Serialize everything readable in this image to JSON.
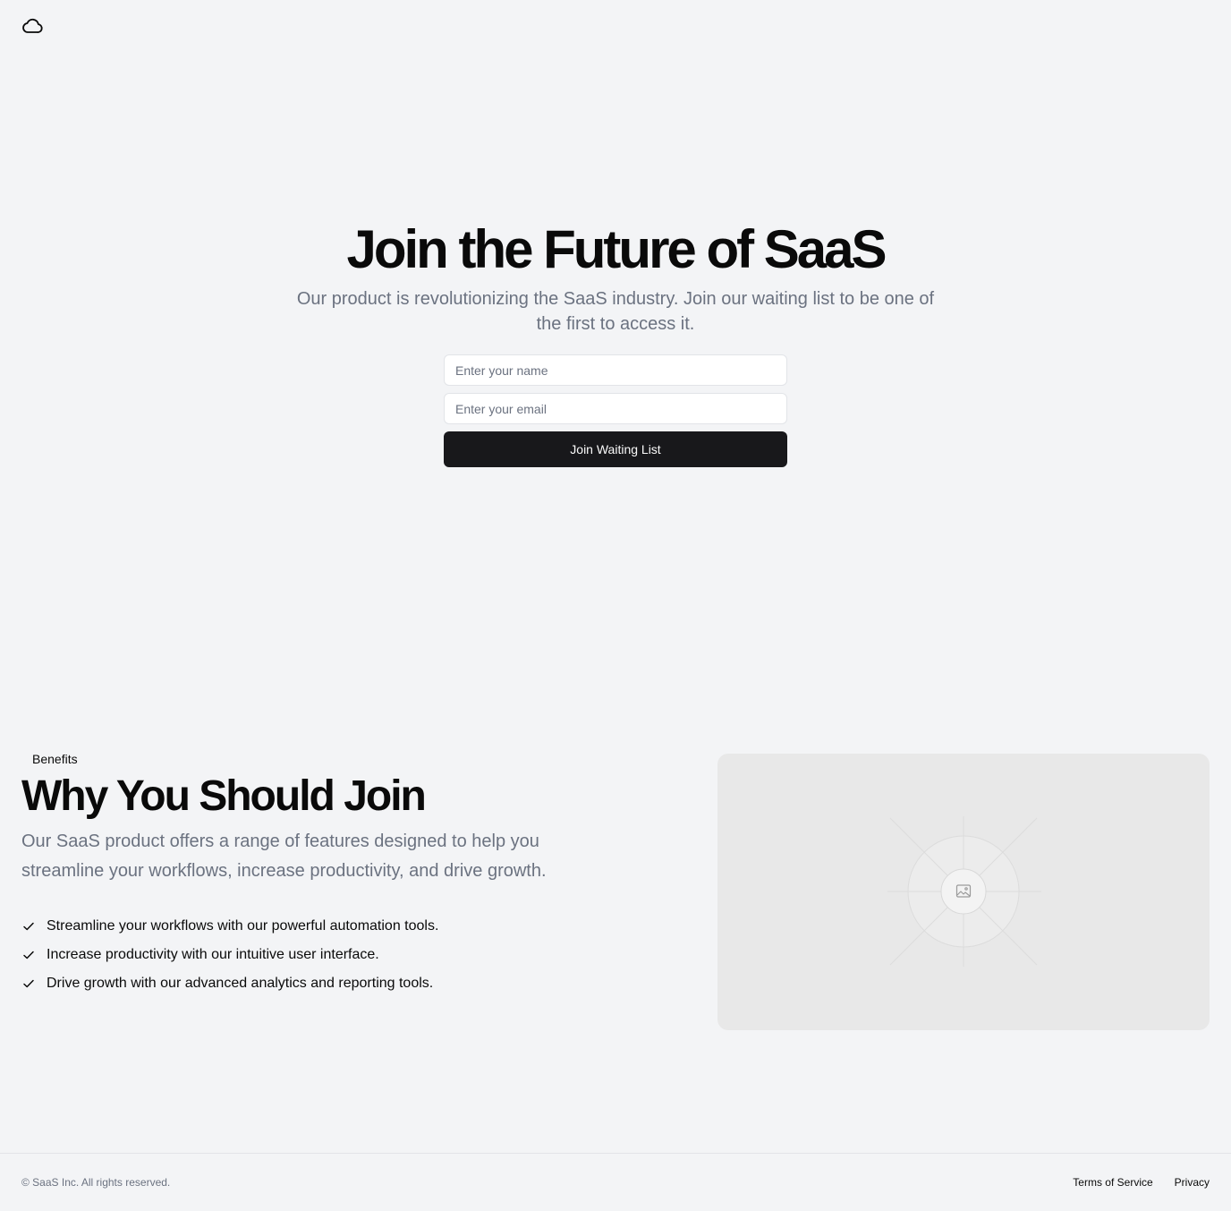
{
  "header": {
    "logo_icon": "cloud-icon"
  },
  "hero": {
    "title": "Join the Future of SaaS",
    "subtitle": "Our product is revolutionizing the SaaS industry. Join our waiting list to be one of the first to access it.",
    "name_placeholder": "Enter your name",
    "email_placeholder": "Enter your email",
    "name_value": "",
    "email_value": "",
    "submit_label": "Join Waiting List"
  },
  "benefits": {
    "badge": "Benefits",
    "title": "Why You Should Join",
    "description": "Our SaaS product offers a range of features designed to help you streamline your workflows, increase productivity, and drive growth.",
    "items": [
      {
        "icon": "check-icon",
        "text": "Streamline your workflows with our powerful automation tools."
      },
      {
        "icon": "check-icon",
        "text": "Increase productivity with our intuitive user interface."
      },
      {
        "icon": "check-icon",
        "text": "Drive growth with our advanced analytics and reporting tools."
      }
    ],
    "image_icon": "image-placeholder-icon"
  },
  "footer": {
    "copyright": "© SaaS Inc. All rights reserved.",
    "links": [
      {
        "label": "Terms of Service"
      },
      {
        "label": "Privacy"
      }
    ]
  },
  "colors": {
    "background": "#f3f4f6",
    "primary_button": "#18181b",
    "muted_text": "#6b7280",
    "placeholder_bg": "#e8e8e8"
  }
}
